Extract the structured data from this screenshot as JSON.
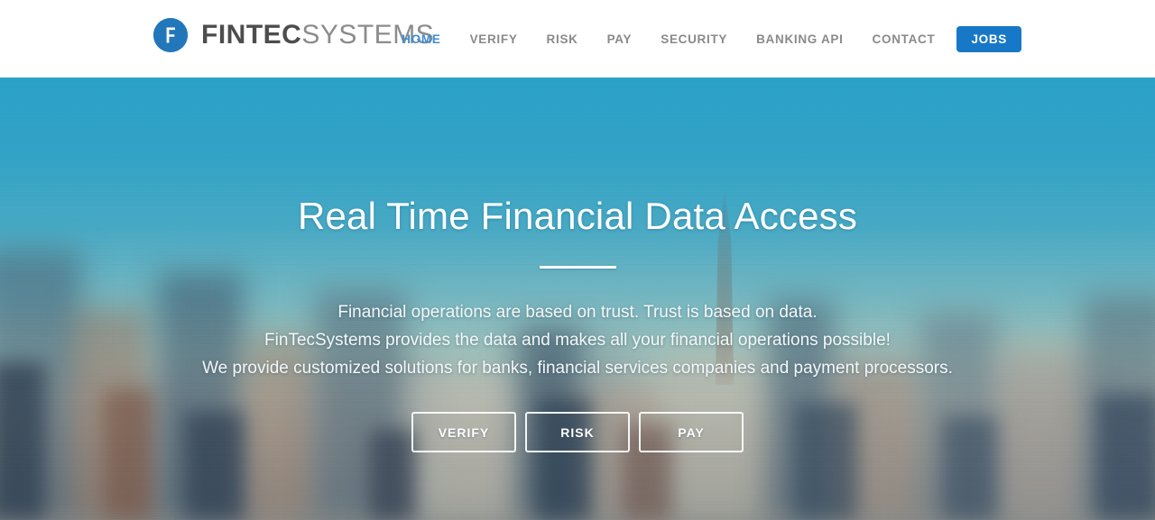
{
  "header": {
    "logo": {
      "icon": "fintecsystems-circle-f-logo",
      "mark_letter": "F",
      "word_primary": "FINTEC",
      "word_secondary": "SYSTEMS",
      "mark_color": "#2277bb"
    },
    "nav": [
      {
        "label": "HOME",
        "active": true,
        "cta": false
      },
      {
        "label": "VERIFY",
        "active": false,
        "cta": false
      },
      {
        "label": "RISK",
        "active": false,
        "cta": false
      },
      {
        "label": "PAY",
        "active": false,
        "cta": false
      },
      {
        "label": "SECURITY",
        "active": false,
        "cta": false
      },
      {
        "label": "BANKING API",
        "active": false,
        "cta": false
      },
      {
        "label": "CONTACT",
        "active": false,
        "cta": false
      },
      {
        "label": "JOBS",
        "active": false,
        "cta": true
      }
    ],
    "colors": {
      "active_link": "#3b8fd4",
      "link": "#8a8a8a",
      "cta_bg": "#1878c8",
      "cta_text": "#ffffff"
    }
  },
  "hero": {
    "title": "Real Time Financial Data Access",
    "divider": true,
    "paragraph_lines": [
      "Financial operations are based on trust. Trust is based on data.",
      "FinTecSystems provides the data and makes all your financial operations possible!",
      "We provide customized solutions for banks, financial services companies and payment processors."
    ],
    "buttons": [
      {
        "label": "VERIFY"
      },
      {
        "label": "RISK"
      },
      {
        "label": "PAY"
      }
    ],
    "background": {
      "description": "blurred city skyline photograph",
      "sky_color": "#2ba4cc"
    }
  }
}
